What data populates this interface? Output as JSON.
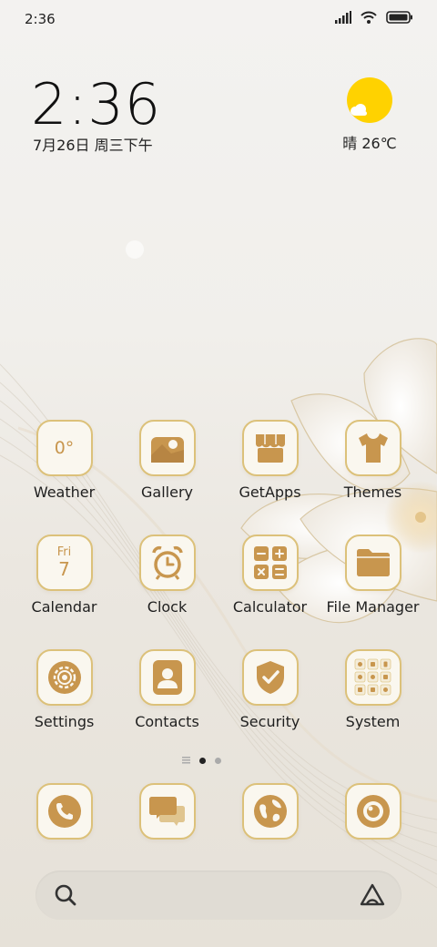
{
  "status_bar": {
    "time": "2:36",
    "icons": [
      "signal-icon",
      "wifi-icon",
      "battery-icon"
    ]
  },
  "widget": {
    "time": "2:36",
    "date": "7月26日 周三下午",
    "weather": "晴 26℃",
    "weather_icon": "sun-cloud-icon"
  },
  "apps": [
    {
      "id": "weather",
      "label": "Weather",
      "icon": "weather-icon",
      "icon_text": "0°"
    },
    {
      "id": "gallery",
      "label": "Gallery",
      "icon": "gallery-icon"
    },
    {
      "id": "getapps",
      "label": "GetApps",
      "icon": "store-icon"
    },
    {
      "id": "themes",
      "label": "Themes",
      "icon": "tshirt-icon"
    },
    {
      "id": "calendar",
      "label": "Calendar",
      "icon": "calendar-icon",
      "icon_day": "Fri",
      "icon_date": "7"
    },
    {
      "id": "clock",
      "label": "Clock",
      "icon": "alarm-clock-icon"
    },
    {
      "id": "calculator",
      "label": "Calculator",
      "icon": "calculator-icon"
    },
    {
      "id": "file-manager",
      "label": "File Manager",
      "icon": "folder-icon"
    },
    {
      "id": "settings",
      "label": "Settings",
      "icon": "gear-icon"
    },
    {
      "id": "contacts",
      "label": "Contacts",
      "icon": "contact-card-icon"
    },
    {
      "id": "security",
      "label": "Security",
      "icon": "shield-check-icon"
    },
    {
      "id": "system",
      "label": "System",
      "icon": "folder-grid-icon"
    }
  ],
  "dock": [
    {
      "id": "phone",
      "icon": "phone-icon"
    },
    {
      "id": "messages",
      "icon": "chat-bubbles-icon"
    },
    {
      "id": "browser",
      "icon": "globe-icon"
    },
    {
      "id": "camera",
      "icon": "camera-lens-icon"
    }
  ],
  "pagination": {
    "pages": 2,
    "current": 1
  },
  "search": {
    "icon": "search-icon",
    "assistant_icon": "assistant-icon"
  },
  "colors": {
    "accent": "#c8964e",
    "icon_bg": "#faf7ef",
    "icon_border": "#dcc17a",
    "sun": "#ffd200"
  }
}
